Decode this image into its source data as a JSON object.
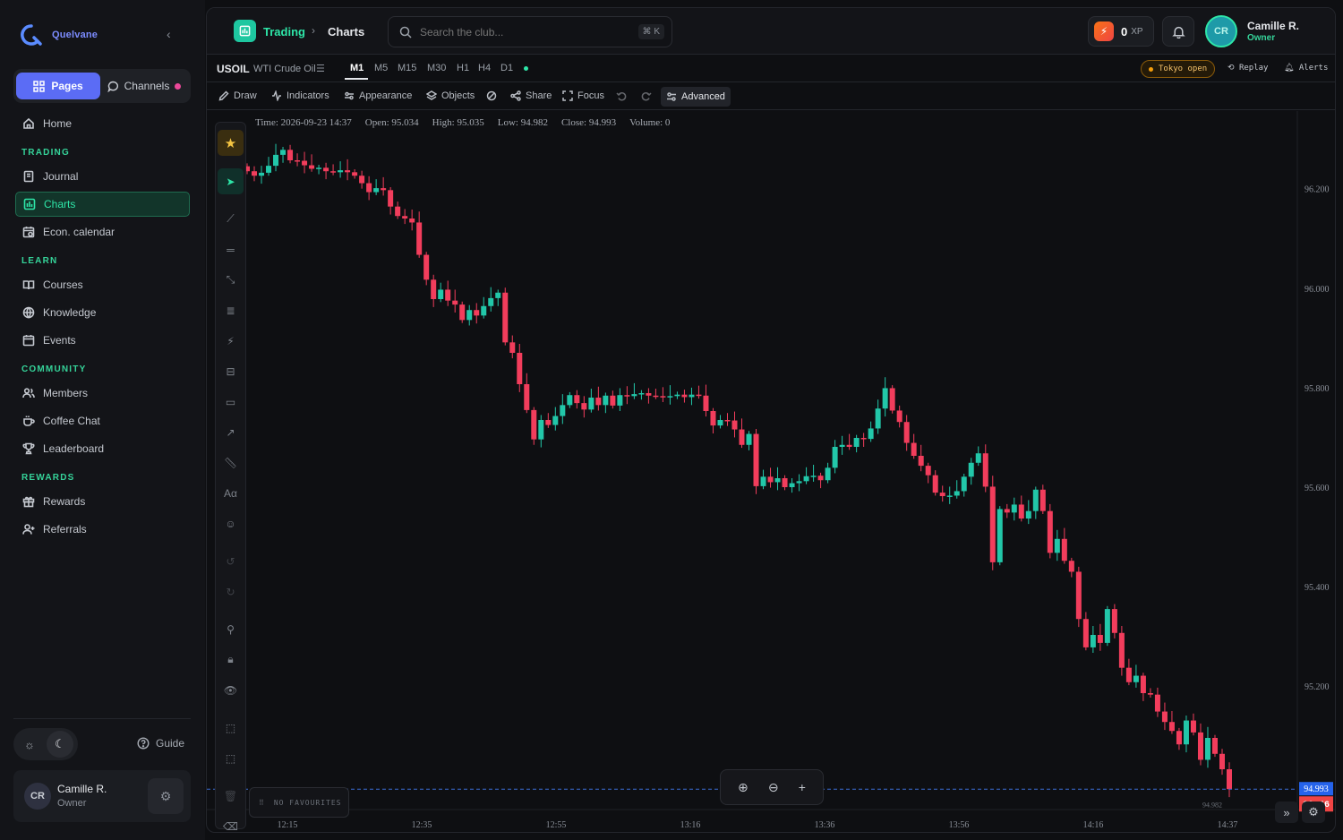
{
  "brand": {
    "name": "Quelvane"
  },
  "sidebar": {
    "seg_pages": "Pages",
    "seg_channels": "Channels",
    "home": "Home",
    "sections": {
      "trading": "TRADING",
      "learn": "LEARN",
      "community": "COMMUNITY",
      "rewards": "REWARDS"
    },
    "items": {
      "journal": "Journal",
      "charts": "Charts",
      "econ": "Econ. calendar",
      "courses": "Courses",
      "knowledge": "Knowledge",
      "events": "Events",
      "members": "Members",
      "coffee": "Coffee Chat",
      "leaderboard": "Leaderboard",
      "rewards": "Rewards",
      "referrals": "Referrals"
    },
    "guide": "Guide",
    "user": {
      "initials": "CR",
      "name": "Camille R.",
      "role": "Owner"
    }
  },
  "topbar": {
    "crumb1": "Trading",
    "crumb2": "Charts",
    "search_placeholder": "Search the club...",
    "shortcut": "⌘ K",
    "xp_value": "0",
    "xp_unit": "XP",
    "user": {
      "initials": "CR",
      "name": "Camille R.",
      "role": "Owner"
    }
  },
  "symbol_bar": {
    "symbol": "USOIL",
    "name": "WTI Crude Oil",
    "timeframes": [
      "M1",
      "M5",
      "M15",
      "M30",
      "H1",
      "H4",
      "D1"
    ],
    "active_timeframe": "M1",
    "session": "Tokyo open",
    "replay": "Replay",
    "alerts": "Alerts"
  },
  "toolbar": {
    "draw": "Draw",
    "indicators": "Indicators",
    "appearance": "Appearance",
    "objects": "Objects",
    "share": "Share",
    "focus": "Focus",
    "advanced": "Advanced"
  },
  "ohlc": {
    "time": "Time: 2026-09-23 14:37",
    "open": "Open: 95.034",
    "high": "High: 95.035",
    "low": "Low: 94.982",
    "close": "Close: 94.993",
    "volume": "Volume: 0"
  },
  "favourites": "NO FAVOURITES",
  "colors": {
    "up": "#22c7a9",
    "down": "#f23d5c",
    "accent": "#2ee6a8"
  },
  "chart_data": {
    "type": "candlestick",
    "y_ticks": [
      "96.200",
      "96.000",
      "95.800",
      "95.600",
      "95.400",
      "95.200"
    ],
    "x_ticks": [
      "12:15",
      "12:35",
      "12:55",
      "13:16",
      "13:36",
      "13:56",
      "14:16",
      "14:37"
    ],
    "ylim": [
      94.97,
      96.32
    ],
    "last_price": "94.993",
    "low_label": "94.982",
    "countdown": "00:46",
    "closes": [
      96.235,
      96.226,
      96.232,
      96.246,
      96.268,
      96.278,
      96.257,
      96.256,
      96.247,
      96.24,
      96.242,
      96.235,
      96.233,
      96.237,
      96.233,
      96.226,
      96.211,
      96.193,
      96.201,
      96.197,
      96.164,
      96.145,
      96.14,
      96.132,
      96.067,
      96.017,
      95.978,
      95.997,
      95.975,
      95.967,
      95.936,
      95.956,
      95.945,
      95.964,
      95.98,
      95.991,
      95.891,
      95.87,
      95.807,
      95.755,
      95.696,
      95.735,
      95.725,
      95.743,
      95.765,
      95.785,
      95.769,
      95.756,
      95.78,
      95.765,
      95.784,
      95.764,
      95.785,
      95.783,
      95.787,
      95.789,
      95.784,
      95.783,
      95.782,
      95.783,
      95.786,
      95.781,
      95.786,
      95.784,
      95.753,
      95.724,
      95.735,
      95.734,
      95.716,
      95.685,
      95.707,
      95.602,
      95.621,
      95.61,
      95.618,
      95.6,
      95.608,
      95.612,
      95.622,
      95.623,
      95.614,
      95.639,
      95.681,
      95.685,
      95.681,
      95.699,
      95.697,
      95.718,
      95.758,
      95.799,
      95.754,
      95.731,
      95.689,
      95.663,
      95.643,
      95.624,
      95.589,
      95.582,
      95.583,
      95.592,
      95.621,
      95.649,
      95.668,
      95.601,
      95.449,
      95.556,
      95.549,
      95.565,
      95.537,
      95.552,
      95.595,
      95.552,
      95.468,
      95.496,
      95.452,
      95.43,
      95.335,
      95.278,
      95.303,
      95.287,
      95.355,
      95.307,
      95.237,
      95.208,
      95.221,
      95.186,
      95.183,
      95.149,
      95.128,
      95.11,
      95.083,
      95.131,
      95.107,
      95.052,
      95.096,
      95.064,
      95.033,
      94.993
    ]
  }
}
